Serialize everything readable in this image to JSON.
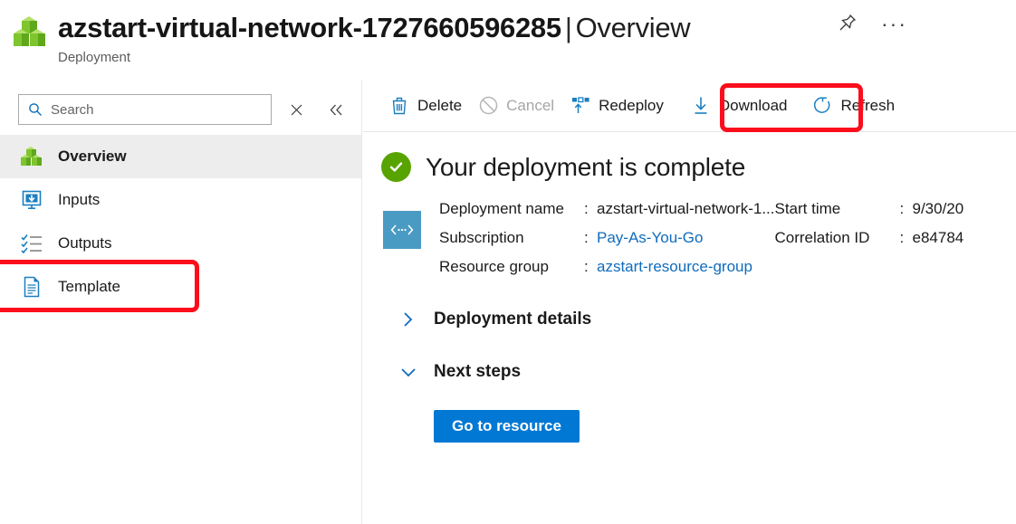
{
  "header": {
    "resource_name": "azstart-virtual-network-1727660596285",
    "separator": "|",
    "page": "Overview",
    "subtitle": "Deployment",
    "pin_icon": "pin-icon",
    "more_label": "···"
  },
  "sidebar": {
    "search": {
      "placeholder": "Search",
      "value": "",
      "icon": "search-icon"
    },
    "close_label": "×",
    "collapse_label": "«",
    "items": [
      {
        "label": "Overview",
        "icon": "cubes-icon",
        "active": true
      },
      {
        "label": "Inputs",
        "icon": "inputs-download-icon",
        "active": false
      },
      {
        "label": "Outputs",
        "icon": "outputs-checklist-icon",
        "active": false
      },
      {
        "label": "Template",
        "icon": "document-icon",
        "active": false
      }
    ]
  },
  "toolbar": {
    "buttons": [
      {
        "label": "Delete",
        "icon": "trash-icon",
        "disabled": false
      },
      {
        "label": "Cancel",
        "icon": "ban-icon",
        "disabled": true
      },
      {
        "label": "Redeploy",
        "icon": "redeploy-icon",
        "disabled": false
      },
      {
        "label": "Download",
        "icon": "download-arrow-icon",
        "disabled": false
      },
      {
        "label": "Refresh",
        "icon": "refresh-icon",
        "disabled": false
      }
    ]
  },
  "main": {
    "status_title": "Your deployment is complete",
    "status_icon": "green-check-icon",
    "info_icon": "deployment-code-icon",
    "details": {
      "deployment_name_label": "Deployment name",
      "deployment_name_value": "azstart-virtual-network-1...",
      "subscription_label": "Subscription",
      "subscription_value": "Pay-As-You-Go",
      "resource_group_label": "Resource group",
      "resource_group_value": "azstart-resource-group",
      "start_time_label": "Start time",
      "start_time_value": "9/30/20",
      "correlation_id_label": "Correlation ID",
      "correlation_id_value": "e84784",
      "colon": ":"
    },
    "sections": [
      {
        "label": "Deployment details",
        "expanded": false,
        "icon": "chevron-right-icon"
      },
      {
        "label": "Next steps",
        "expanded": true,
        "icon": "chevron-down-icon"
      }
    ],
    "go_to_resource_label": "Go to resource"
  },
  "annotations": {
    "highlight_color": "#fc0d1b",
    "boxes": [
      {
        "target": "Template",
        "name": "template-highlight"
      },
      {
        "target": "Download",
        "name": "download-highlight"
      }
    ]
  },
  "colors": {
    "accent_blue": "#0078d4",
    "link_blue": "#0f6cbd",
    "success_green": "#57a300",
    "info_teal": "#4a9bc4",
    "highlight_red": "#fc0d1b",
    "active_nav_bg": "#ededed"
  }
}
